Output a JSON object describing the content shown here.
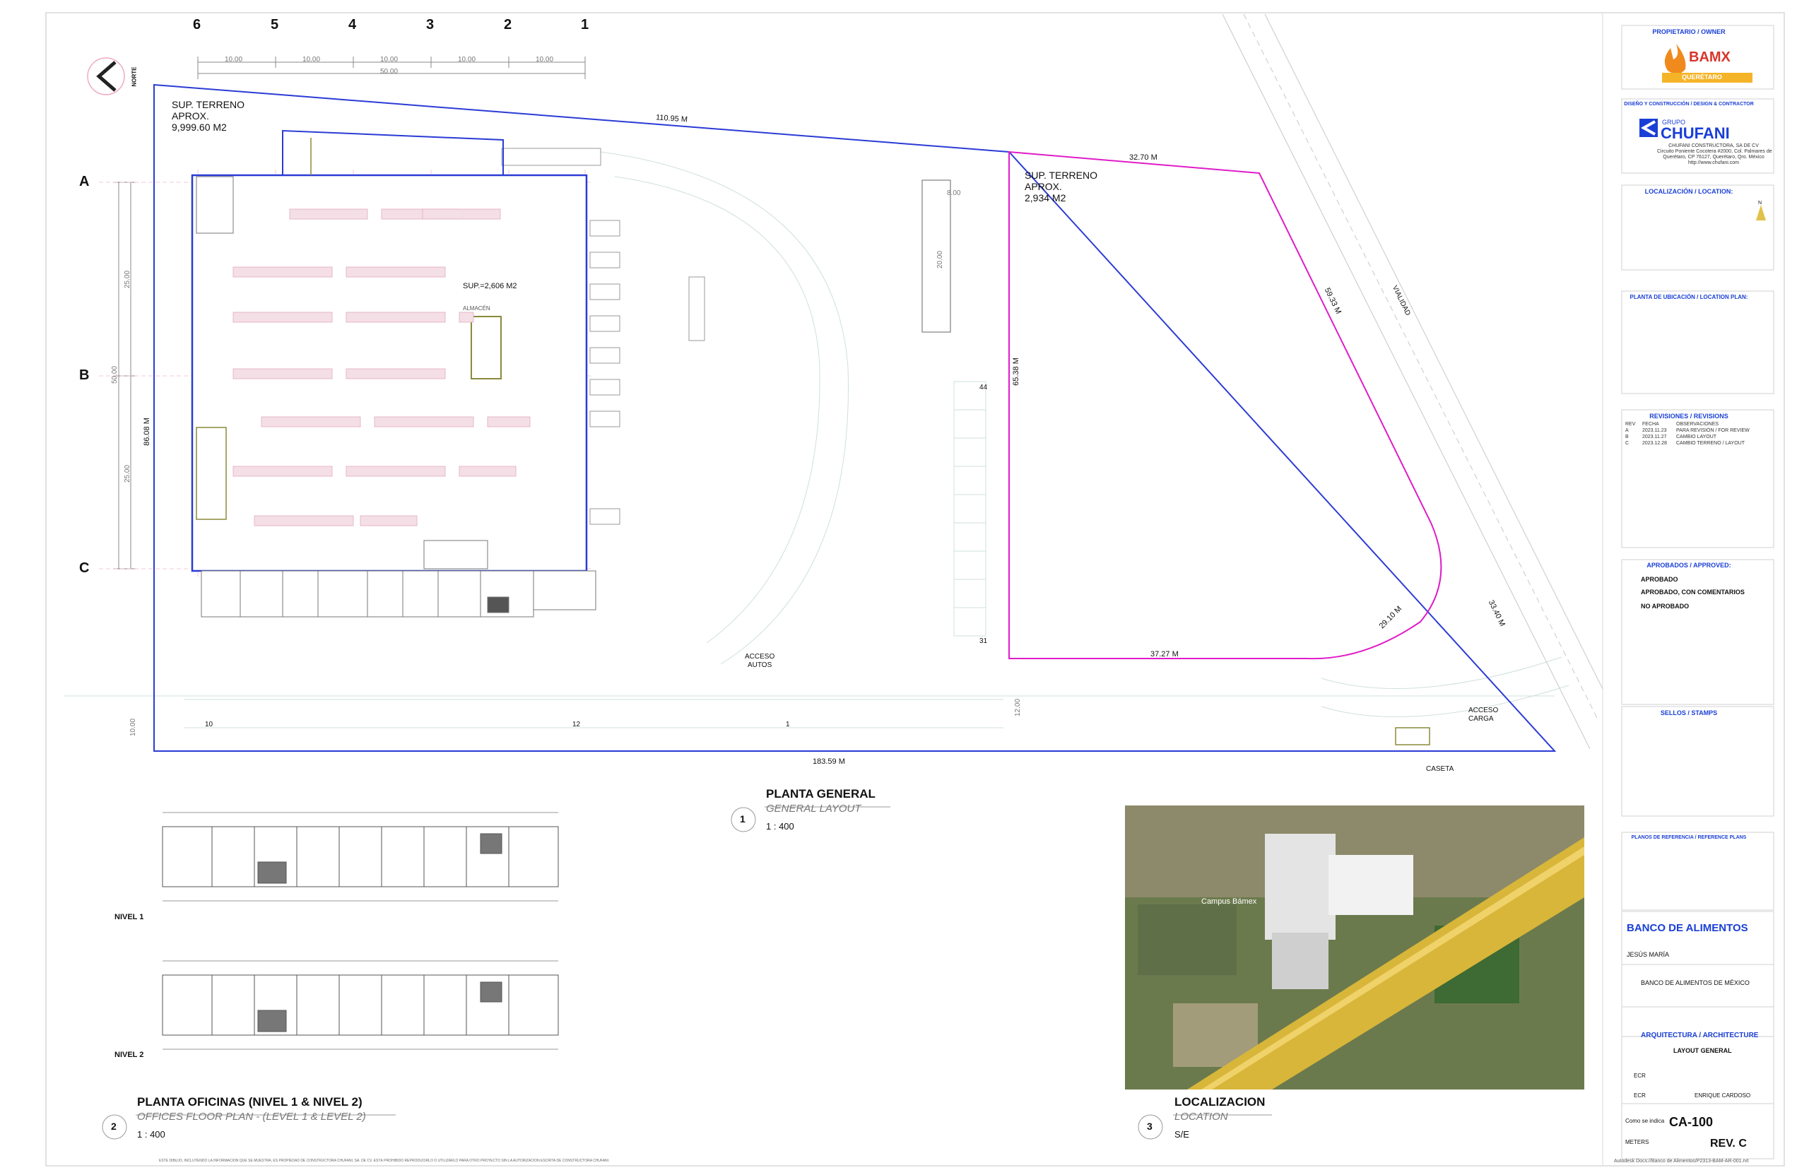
{
  "colors": {
    "blue_boundary": "#2b3bd6",
    "magenta_boundary": "#e01cc8",
    "title_blue": "#1a3fd6",
    "building_olive": "#8a8a3a"
  },
  "grid": {
    "columns": [
      "6",
      "5",
      "4",
      "3",
      "2",
      "1"
    ],
    "rows": [
      "A",
      "B",
      "C"
    ],
    "col_dims": [
      "10.00",
      "10.00",
      "10.00",
      "10.00",
      "10.00"
    ],
    "col_total": "50.00",
    "row_dims": [
      "25.00",
      "25.00"
    ],
    "row_total": "50.00"
  },
  "north": {
    "label": "NORTE"
  },
  "site": {
    "left_label_1": "SUP. TERRENO",
    "left_label_2": "APROX.",
    "left_area": "9,999.60 M2",
    "right_label_1": "SUP. TERRENO",
    "right_label_2": "APROX.",
    "right_area": "2,934 M2",
    "dim_top": "110.95 M",
    "dim_bottom": "183.59 M",
    "dim_left": "86.08 M",
    "dim_right_top": "32.70 M",
    "dim_right_diag": "59.33 M",
    "dim_right_vert": "65.38 M",
    "dim_curve": "29.10 M",
    "dim_right_bottom": "37.27 M",
    "dim_edge": "33.40 M",
    "dim_box_w": "8.00",
    "dim_box_h": "20.00",
    "dim_small_1": "10.00",
    "dim_small_2": "12.00",
    "warehouse_area": "SUP.=2,606 M2",
    "warehouse_name": "ALMACÉN",
    "road": "VIALIDAD",
    "access_cars_1": "ACCESO",
    "access_cars_2": "AUTOS",
    "access_load_1": "ACCESO",
    "access_load_2": "CARGA",
    "booth": "CASETA",
    "parking_counts": [
      "44",
      "31",
      "10",
      "12",
      "1"
    ]
  },
  "views": [
    {
      "num": "1",
      "title": "PLANTA GENERAL",
      "subtitle": "GENERAL LAYOUT",
      "scale": "1 : 400"
    },
    {
      "num": "2",
      "title": "PLANTA OFICINAS (NIVEL 1 & NIVEL 2)",
      "subtitle": "OFFICES FLOOR PLAN - (LEVEL 1 & LEVEL 2)",
      "scale": "1 : 400"
    },
    {
      "num": "3",
      "title": "LOCALIZACION",
      "subtitle": "LOCATION",
      "scale": "S/E"
    }
  ],
  "offices": {
    "level1": "NIVEL 1",
    "level2": "NIVEL 2"
  },
  "map": {
    "label": "Campus Bámex"
  },
  "title_block": {
    "owner_head": "PROPIETARIO / OWNER",
    "owner_logo_1": "BAMX",
    "owner_logo_2": "QUERÉTARO",
    "design_head": "DISEÑO Y CONSTRUCCIÓN / DESIGN & CONTRACTOR",
    "contractor_small": "GRUPO",
    "contractor_name": "CHUFANI",
    "contractor_line1": "CHUFANI CONSTRUCTORA, SA DE CV",
    "contractor_line2": "Circuito Poniente Cocotera #2000, Col. Palmares de",
    "contractor_line3": "Querétaro, CP 76127, Querétaro, Qro. México",
    "contractor_line4": "http://www.chufani.com",
    "location_head": "LOCALIZACIÓN / LOCATION:",
    "location_n": "N",
    "plan_location_head": "PLANTA DE UBICACIÓN / LOCATION PLAN:",
    "revisions_head": "REVISIONES / REVISIONS",
    "revisions_cols": [
      "REV",
      "FECHA",
      "OBSERVACIONES"
    ],
    "revisions": [
      {
        "rev": "A",
        "date": "2023.11.23",
        "obs": "PARA REVISIÓN / FOR REVIEW"
      },
      {
        "rev": "B",
        "date": "2023.11.27",
        "obs": "CAMBIO LAYOUT"
      },
      {
        "rev": "C",
        "date": "2023.12.28",
        "obs": "CAMBIO TERRENO / LAYOUT"
      }
    ],
    "approved_head": "APROBADOS / APPROVED:",
    "approved": "APROBADO",
    "approved_comments": "APROBADO, CON COMENTARIOS",
    "not_approved": "NO APROBADO",
    "stamps_head": "SELLOS / STAMPS",
    "ref_head": "PLANOS DE REFERENCIA / REFERENCE PLANS",
    "project_name": "BANCO DE ALIMENTOS",
    "location_value": "JESÚS MARÍA",
    "owner_value": "BANCO DE ALIMENTOS DE MÉXICO",
    "discipline": "ARQUITECTURA / ARCHITECTURE",
    "drawing_title": "LAYOUT GENERAL",
    "drawn_by": "ECR",
    "checked_by": "ECR",
    "reviewer": "ENRIQUE CARDOSO",
    "scale_value": "Como se indica",
    "sheet_code": "CA-100",
    "revision": "REV. C",
    "units": "METERS",
    "file_path": "Autodesk Docs://Banco de Alimentos/P2313-BAM-AR-001.rvt"
  },
  "legal_note": "ESTE DIBUJO, INCLUYENDO LA INFORMACIÓN QUE SE MUESTRA, ES PROPIEDAD DE CONSTRUCTORA CHUFANI, SA. DE CV. ESTÁ PROHIBIDO REPRODUCIRLO O UTILIZARLO PARA OTRO PROYECTO SIN LA AUTORIZACIÓN ESCRITA DE CONSTRUCTORA CHUFANI."
}
